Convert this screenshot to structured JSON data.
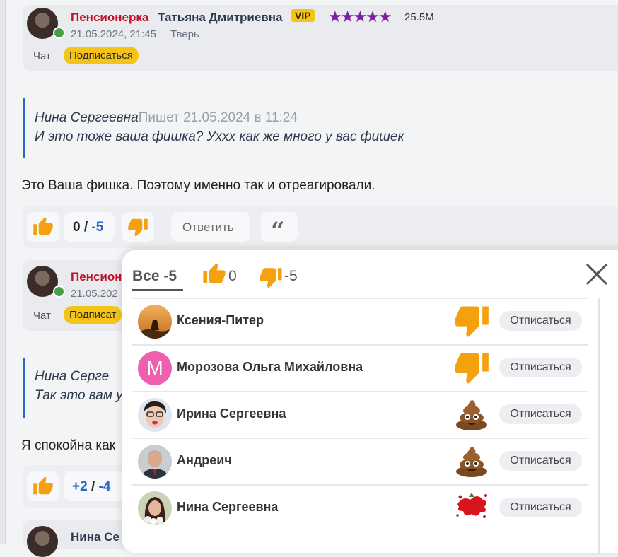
{
  "post1": {
    "rank": "Пенсионерка",
    "name": "Татьяна Дмитриевна",
    "vip": "VIP",
    "stars": "★★★★★",
    "count": "25.5M",
    "date": "21.05.2024, 21:45",
    "city": "Тверь",
    "chat": "Чат",
    "subscribe": "Подписаться"
  },
  "quote1": {
    "author": "Нина Сергеевна",
    "meta": "Пишет 21.05.2024 в 11:24",
    "text": "И это тоже ваша фишка? Уххх как же много у вас фишек"
  },
  "comment1": "Это Ваша фишка. Поэтому именно так и отреагировали.",
  "actions1": {
    "plus": "0",
    "sep": " / ",
    "minus": "-5",
    "reply": "Ответить",
    "quote_icon": "“"
  },
  "post2": {
    "rank": "Пенсион",
    "date": "21.05.202",
    "chat": "Чат",
    "subscribe": "Подписат"
  },
  "quote2": {
    "author": "Нина Серге",
    "text": "Так это вам у"
  },
  "comment2": "Я спокойна как",
  "actions2": {
    "plus": "+2",
    "sep": " / ",
    "minus": "-4"
  },
  "post3": {
    "name": "Нина Се"
  },
  "modal": {
    "tab_all": "Все -5",
    "likes_count": "0",
    "dislikes_count": "-5",
    "unsubscribe_label": "Отписаться",
    "reactors": [
      {
        "name": "Ксения-Питер",
        "reaction": "thumbs-down-icon",
        "avatar": "sunset-photo"
      },
      {
        "name": "Морозова Ольга Михайловна",
        "reaction": "thumbs-down-icon",
        "avatar": "letter",
        "letter": "М"
      },
      {
        "name": "Ирина Сергеевна",
        "reaction": "poop-icon",
        "avatar": "woman-photo"
      },
      {
        "name": "Андреич",
        "reaction": "poop-icon",
        "avatar": "man-photo"
      },
      {
        "name": "Нина Сергеевна",
        "reaction": "tomato-splat-icon",
        "avatar": "woman-flowers-photo"
      }
    ]
  },
  "colors": {
    "rank_red": "#c0132b",
    "accent_blue": "#2d64c8",
    "vip_yellow": "#f4c518",
    "stars_purple": "#7b1fa2",
    "reaction_orange": "#f5a00f"
  }
}
